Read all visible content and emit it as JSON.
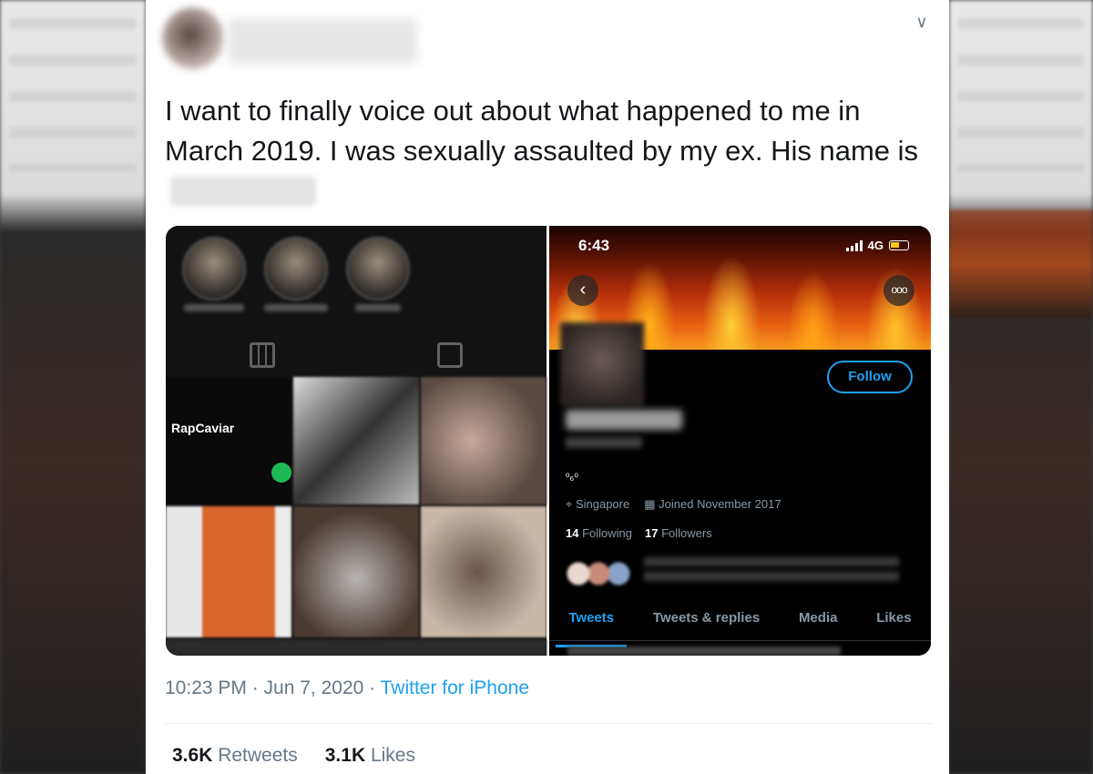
{
  "tweet": {
    "text_line": "I want to finally voice out about what happened to me in March 2019. I was sexually assaulted by my ex. His name is",
    "timestamp": "10:23 PM · Jun 7, 2020",
    "separator": " · ",
    "source": "Twitter for iPhone",
    "retweets_count": "3.6K",
    "retweets_label": "Retweets",
    "likes_count": "3.1K",
    "likes_label": "Likes",
    "caret_icon": "chevron-down-icon"
  },
  "media": {
    "left_panel": {
      "thumb_label": "RapCaviar"
    },
    "right_panel": {
      "status_time": "6:43",
      "network": "4G",
      "back_icon": "‹",
      "more_icon": "ooo",
      "follow_label": "Follow",
      "bio": "ᵒ₆ᵒ",
      "location": "Singapore",
      "joined": "Joined November 2017",
      "following_count": "14",
      "following_label": "Following",
      "followers_count": "17",
      "followers_label": "Followers",
      "tabs": [
        "Tweets",
        "Tweets & replies",
        "Media",
        "Likes"
      ],
      "active_tab": "Tweets"
    }
  },
  "colors": {
    "link": "#1da1f2",
    "muted": "#657786",
    "text": "#14171a"
  }
}
